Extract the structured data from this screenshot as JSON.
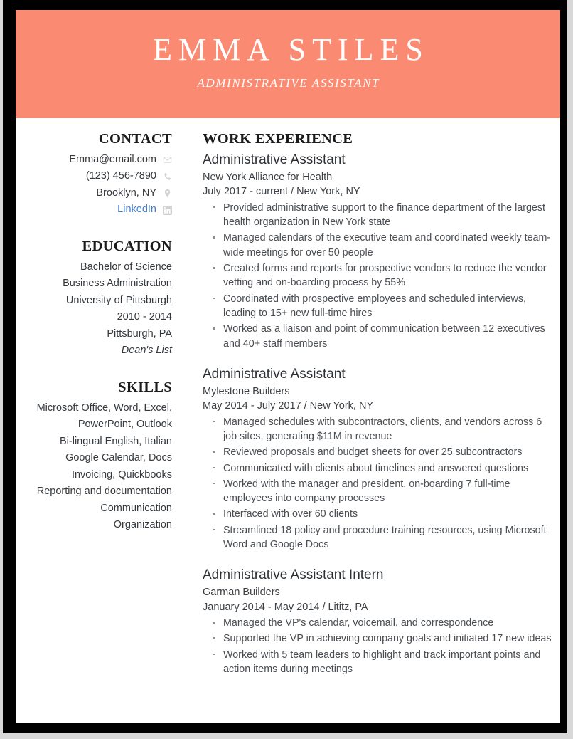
{
  "theme": {
    "accent": "#fb8a72",
    "link": "#3f7cc9",
    "text": "#35393d",
    "heading": "#1b1b1b",
    "icon": "#d2d2d2",
    "frame": "#000000",
    "page": "#ffffff"
  },
  "header": {
    "name": "EMMA STILES",
    "subtitle": "ADMINISTRATIVE ASSISTANT"
  },
  "sidebar": {
    "contact": {
      "heading": "CONTACT",
      "items": [
        {
          "text": "Emma@email.com",
          "icon": "envelope-icon",
          "is_link": false
        },
        {
          "text": "(123) 456-7890",
          "icon": "phone-icon",
          "is_link": false
        },
        {
          "text": "Brooklyn, NY",
          "icon": "location-pin-icon",
          "is_link": false
        },
        {
          "text": "LinkedIn",
          "icon": "linkedin-icon",
          "is_link": true
        }
      ]
    },
    "education": {
      "heading": "EDUCATION",
      "lines": [
        {
          "text": "Bachelor of Science",
          "italic": false
        },
        {
          "text": "Business Administration",
          "italic": false
        },
        {
          "text": "University of Pittsburgh",
          "italic": false
        },
        {
          "text": "2010 - 2014",
          "italic": false
        },
        {
          "text": "Pittsburgh, PA",
          "italic": false
        },
        {
          "text": "Dean's List",
          "italic": true
        }
      ]
    },
    "skills": {
      "heading": "SKILLS",
      "lines": [
        {
          "text": "Microsoft Office, Word, Excel, PowerPoint, Outlook",
          "italic": false
        },
        {
          "text": "Bi-lingual English, Italian",
          "italic": false
        },
        {
          "text": "Google Calendar, Docs",
          "italic": false
        },
        {
          "text": "Invoicing, Quickbooks",
          "italic": false
        },
        {
          "text": "Reporting and documentation",
          "italic": false
        },
        {
          "text": "Communication",
          "italic": false
        },
        {
          "text": "Organization",
          "italic": false
        }
      ]
    }
  },
  "main": {
    "work_experience": {
      "heading": "WORK EXPERIENCE",
      "jobs": [
        {
          "title": "Administrative Assistant",
          "company": "New York Alliance for Health",
          "dates": "July 2017 - current",
          "separator": "/",
          "location": "New York, NY",
          "bullets": [
            "Provided administrative support to the finance department of the largest health organization in New York state",
            "Managed calendars of the executive team and coordinated weekly team-wide meetings for over 50 people",
            "Created forms and reports for prospective vendors to reduce the vendor vetting and on-boarding process by 55%",
            "Coordinated with prospective employees and scheduled interviews, leading to 15+ new full-time hires",
            "Worked as a liaison and point of communication between 12 executives and 40+ staff members"
          ]
        },
        {
          "title": "Administrative Assistant",
          "company": "Mylestone Builders",
          "dates": "May 2014 - July 2017",
          "separator": "/",
          "location": "New York, NY",
          "bullets": [
            "Managed schedules with subcontractors, clients, and vendors across 6 job sites, generating $11M in revenue",
            "Reviewed proposals and budget sheets for over 25 subcontractors",
            "Communicated with clients about timelines and answered questions",
            "Worked with the manager and president, on-boarding 7 full-time employees into company processes",
            "Interfaced with over 60 clients",
            "Streamlined 18 policy and procedure training resources, using Microsoft Word and Google Docs"
          ]
        },
        {
          "title": "Administrative Assistant Intern",
          "company": "Garman Builders",
          "dates": "January 2014 - May 2014",
          "separator": "/",
          "location": "Lititz, PA",
          "bullets": [
            "Managed the VP's calendar, voicemail, and correspondence",
            "Supported the VP in achieving company goals and initiated 17 new ideas",
            "Worked with 5 team leaders to highlight and track important points and action items during meetings"
          ]
        }
      ]
    }
  }
}
